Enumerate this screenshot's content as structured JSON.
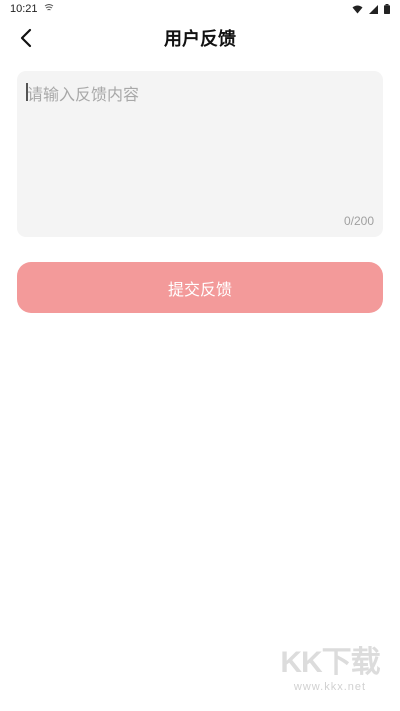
{
  "status_bar": {
    "time": "10:21"
  },
  "nav": {
    "title": "用户反馈"
  },
  "feedback": {
    "placeholder": "请输入反馈内容",
    "value": "",
    "char_count": "0/200"
  },
  "submit": {
    "label": "提交反馈"
  },
  "watermark": {
    "logo_text": "KK下载",
    "url": "www.kkx.net"
  },
  "colors": {
    "submit_bg": "#f39a9a",
    "input_bg": "#f4f4f4"
  },
  "icons": [
    "notification-icon",
    "wifi-icon",
    "signal-icon",
    "battery-icon",
    "back-arrow-icon"
  ]
}
